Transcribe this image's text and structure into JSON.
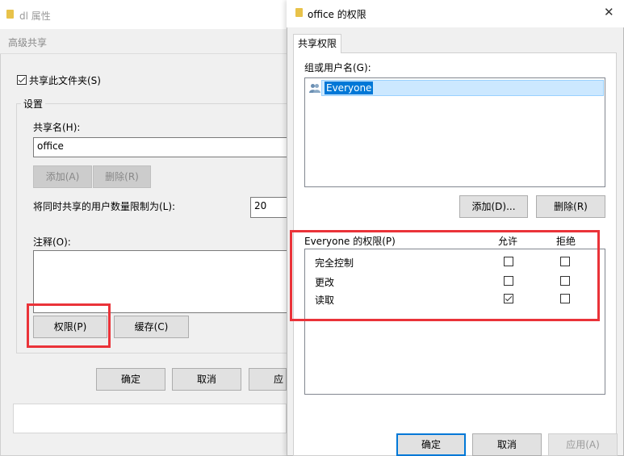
{
  "back_window": {
    "title": "dl 属性",
    "dialog_title": "高级共享",
    "share_checkbox_label": "共享此文件夹(S)",
    "share_checked": true,
    "settings_group": "设置",
    "share_name_label": "共享名(H):",
    "share_name_value": "office",
    "add_button": "添加(A)",
    "remove_button": "删除(R)",
    "limit_label": "将同时共享的用户数量限制为(L):",
    "limit_value": "20",
    "comment_label": "注释(O):",
    "permissions_button": "权限(P)",
    "caching_button": "缓存(C)",
    "ok_button": "确定",
    "cancel_button": "取消",
    "apply_button": "应"
  },
  "front_window": {
    "title": "office 的权限",
    "tab_label": "共享权限",
    "group_label": "组或用户名(G):",
    "users": [
      "Everyone"
    ],
    "add_button": "添加(D)...",
    "remove_button": "删除(R)",
    "perm_header": "Everyone 的权限(P)",
    "allow_header": "允许",
    "deny_header": "拒绝",
    "permissions": [
      {
        "name": "完全控制",
        "allow": false,
        "deny": false
      },
      {
        "name": "更改",
        "allow": false,
        "deny": false
      },
      {
        "name": "读取",
        "allow": true,
        "deny": false
      }
    ],
    "ok_button": "确定",
    "cancel_button": "取消",
    "apply_button": "应用(A)"
  },
  "icons": [
    "folder-icon",
    "users-icon",
    "close-icon",
    "checkmark-icon"
  ],
  "colors": {
    "highlight": "#ea3339",
    "selection": "#0078d7"
  }
}
